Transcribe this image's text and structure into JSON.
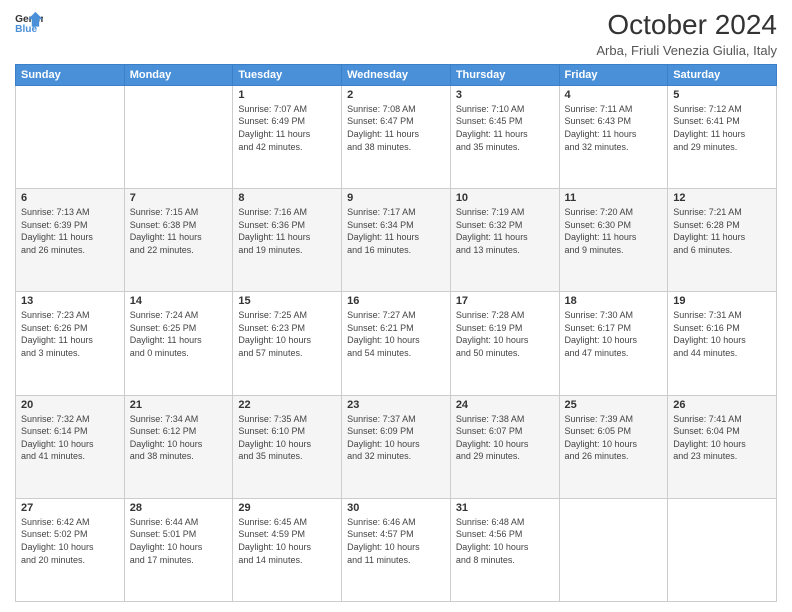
{
  "header": {
    "logo_line1": "General",
    "logo_line2": "Blue",
    "month_year": "October 2024",
    "location": "Arba, Friuli Venezia Giulia, Italy"
  },
  "days_of_week": [
    "Sunday",
    "Monday",
    "Tuesday",
    "Wednesday",
    "Thursday",
    "Friday",
    "Saturday"
  ],
  "weeks": [
    [
      {
        "day": "",
        "detail": ""
      },
      {
        "day": "",
        "detail": ""
      },
      {
        "day": "1",
        "detail": "Sunrise: 7:07 AM\nSunset: 6:49 PM\nDaylight: 11 hours\nand 42 minutes."
      },
      {
        "day": "2",
        "detail": "Sunrise: 7:08 AM\nSunset: 6:47 PM\nDaylight: 11 hours\nand 38 minutes."
      },
      {
        "day": "3",
        "detail": "Sunrise: 7:10 AM\nSunset: 6:45 PM\nDaylight: 11 hours\nand 35 minutes."
      },
      {
        "day": "4",
        "detail": "Sunrise: 7:11 AM\nSunset: 6:43 PM\nDaylight: 11 hours\nand 32 minutes."
      },
      {
        "day": "5",
        "detail": "Sunrise: 7:12 AM\nSunset: 6:41 PM\nDaylight: 11 hours\nand 29 minutes."
      }
    ],
    [
      {
        "day": "6",
        "detail": "Sunrise: 7:13 AM\nSunset: 6:39 PM\nDaylight: 11 hours\nand 26 minutes."
      },
      {
        "day": "7",
        "detail": "Sunrise: 7:15 AM\nSunset: 6:38 PM\nDaylight: 11 hours\nand 22 minutes."
      },
      {
        "day": "8",
        "detail": "Sunrise: 7:16 AM\nSunset: 6:36 PM\nDaylight: 11 hours\nand 19 minutes."
      },
      {
        "day": "9",
        "detail": "Sunrise: 7:17 AM\nSunset: 6:34 PM\nDaylight: 11 hours\nand 16 minutes."
      },
      {
        "day": "10",
        "detail": "Sunrise: 7:19 AM\nSunset: 6:32 PM\nDaylight: 11 hours\nand 13 minutes."
      },
      {
        "day": "11",
        "detail": "Sunrise: 7:20 AM\nSunset: 6:30 PM\nDaylight: 11 hours\nand 9 minutes."
      },
      {
        "day": "12",
        "detail": "Sunrise: 7:21 AM\nSunset: 6:28 PM\nDaylight: 11 hours\nand 6 minutes."
      }
    ],
    [
      {
        "day": "13",
        "detail": "Sunrise: 7:23 AM\nSunset: 6:26 PM\nDaylight: 11 hours\nand 3 minutes."
      },
      {
        "day": "14",
        "detail": "Sunrise: 7:24 AM\nSunset: 6:25 PM\nDaylight: 11 hours\nand 0 minutes."
      },
      {
        "day": "15",
        "detail": "Sunrise: 7:25 AM\nSunset: 6:23 PM\nDaylight: 10 hours\nand 57 minutes."
      },
      {
        "day": "16",
        "detail": "Sunrise: 7:27 AM\nSunset: 6:21 PM\nDaylight: 10 hours\nand 54 minutes."
      },
      {
        "day": "17",
        "detail": "Sunrise: 7:28 AM\nSunset: 6:19 PM\nDaylight: 10 hours\nand 50 minutes."
      },
      {
        "day": "18",
        "detail": "Sunrise: 7:30 AM\nSunset: 6:17 PM\nDaylight: 10 hours\nand 47 minutes."
      },
      {
        "day": "19",
        "detail": "Sunrise: 7:31 AM\nSunset: 6:16 PM\nDaylight: 10 hours\nand 44 minutes."
      }
    ],
    [
      {
        "day": "20",
        "detail": "Sunrise: 7:32 AM\nSunset: 6:14 PM\nDaylight: 10 hours\nand 41 minutes."
      },
      {
        "day": "21",
        "detail": "Sunrise: 7:34 AM\nSunset: 6:12 PM\nDaylight: 10 hours\nand 38 minutes."
      },
      {
        "day": "22",
        "detail": "Sunrise: 7:35 AM\nSunset: 6:10 PM\nDaylight: 10 hours\nand 35 minutes."
      },
      {
        "day": "23",
        "detail": "Sunrise: 7:37 AM\nSunset: 6:09 PM\nDaylight: 10 hours\nand 32 minutes."
      },
      {
        "day": "24",
        "detail": "Sunrise: 7:38 AM\nSunset: 6:07 PM\nDaylight: 10 hours\nand 29 minutes."
      },
      {
        "day": "25",
        "detail": "Sunrise: 7:39 AM\nSunset: 6:05 PM\nDaylight: 10 hours\nand 26 minutes."
      },
      {
        "day": "26",
        "detail": "Sunrise: 7:41 AM\nSunset: 6:04 PM\nDaylight: 10 hours\nand 23 minutes."
      }
    ],
    [
      {
        "day": "27",
        "detail": "Sunrise: 6:42 AM\nSunset: 5:02 PM\nDaylight: 10 hours\nand 20 minutes."
      },
      {
        "day": "28",
        "detail": "Sunrise: 6:44 AM\nSunset: 5:01 PM\nDaylight: 10 hours\nand 17 minutes."
      },
      {
        "day": "29",
        "detail": "Sunrise: 6:45 AM\nSunset: 4:59 PM\nDaylight: 10 hours\nand 14 minutes."
      },
      {
        "day": "30",
        "detail": "Sunrise: 6:46 AM\nSunset: 4:57 PM\nDaylight: 10 hours\nand 11 minutes."
      },
      {
        "day": "31",
        "detail": "Sunrise: 6:48 AM\nSunset: 4:56 PM\nDaylight: 10 hours\nand 8 minutes."
      },
      {
        "day": "",
        "detail": ""
      },
      {
        "day": "",
        "detail": ""
      }
    ]
  ]
}
